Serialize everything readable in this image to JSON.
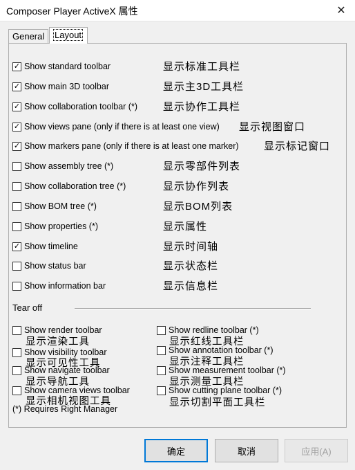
{
  "window": {
    "title": "Composer Player ActiveX 属性",
    "close": "✕"
  },
  "tabs": [
    {
      "label": "General",
      "active": false
    },
    {
      "label": "Layout",
      "active": true
    }
  ],
  "options": [
    {
      "label": "Show standard toolbar",
      "zh": "显示标准工具栏",
      "checked": true
    },
    {
      "label": "Show main 3D toolbar",
      "zh": "显示主3D工具栏",
      "checked": true
    },
    {
      "label": "Show collaboration toolbar (*)",
      "zh": "显示协作工具栏",
      "checked": true
    },
    {
      "label": "Show views pane (only if there is at least one view)",
      "zh": "显示视图窗口",
      "checked": true
    },
    {
      "label": "Show markers pane (only if there is at least one marker)",
      "zh": "显示标记窗口",
      "checked": true
    },
    {
      "label": "Show assembly tree (*)",
      "zh": "显示零部件列表",
      "checked": false
    },
    {
      "label": "Show collaboration tree (*)",
      "zh": "显示协作列表",
      "checked": false
    },
    {
      "label": "Show BOM tree (*)",
      "zh": "显示BOM列表",
      "checked": false
    },
    {
      "label": "Show properties (*)",
      "zh": "显示属性",
      "checked": false
    },
    {
      "label": "Show timeline",
      "zh": "显示时间轴",
      "checked": true
    },
    {
      "label": "Show status bar",
      "zh": "显示状态栏",
      "checked": false
    },
    {
      "label": "Show information bar",
      "zh": "显示信息栏",
      "checked": false
    }
  ],
  "tear_off": {
    "label": "Tear off",
    "left": [
      {
        "label": "Show render toolbar",
        "zh": "显示渲染工具",
        "checked": false
      },
      {
        "label": "Show visibility toolbar",
        "zh": "显示可见性工具",
        "checked": false
      },
      {
        "label": "Show navigate toolbar",
        "zh": "显示导航工具",
        "checked": false
      },
      {
        "label": "Show camera views toolbar",
        "zh": "显示相机视图工具",
        "checked": false
      }
    ],
    "right": [
      {
        "label": "Show redline toolbar (*)",
        "zh": "显示红线工具栏",
        "checked": false
      },
      {
        "label": "Show annotation toolbar (*)",
        "zh": "显示注释工具栏",
        "checked": false
      },
      {
        "label": "Show measurement toolbar (*)",
        "zh": "显示测量工具栏",
        "checked": false
      },
      {
        "label": "Show cutting plane toolbar (*)",
        "zh": "显示切割平面工具栏",
        "checked": false
      }
    ]
  },
  "note": "(*) Requires Right Manager",
  "buttons": {
    "ok": "确定",
    "cancel": "取消",
    "apply": "应用(A)"
  },
  "check_glyph": "✓"
}
